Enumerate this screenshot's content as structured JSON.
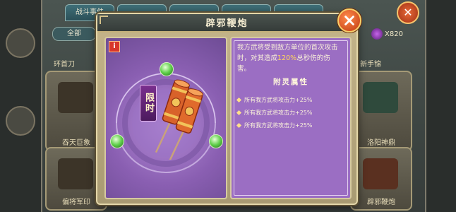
{
  "background": {
    "tabs": [
      "战斗事件",
      "",
      "",
      "",
      ""
    ],
    "filter_label": "全部",
    "currency_value": "X820",
    "cards": [
      {
        "label": "环首刀"
      },
      {
        "label": "吞天巨象"
      },
      {
        "label": "偏将军印"
      },
      {
        "label": "新手锦"
      },
      {
        "label": "洛阳神鼎"
      },
      {
        "label": "辟邪鞭炮"
      }
    ]
  },
  "modal": {
    "title": "辟邪鞭炮",
    "limit_tag": "限时",
    "info_icon_text": "i",
    "description_pre": "我方武将受到敌方单位的首次攻击时，对其造成",
    "description_highlight": "120%",
    "description_post": "总秒伤的伤害。",
    "attributes_title": "附灵属性",
    "attributes": [
      "所有我方武将攻击力+25%",
      "所有我方武将攻击力+25%",
      "所有我方武将攻击力+25%"
    ],
    "colors": {
      "highlight": "#ffd75a",
      "panel_purple": "#9b6ec3",
      "close_orange": "#e85a20"
    },
    "icons": [
      "close-icon",
      "info-icon",
      "firecracker-icon",
      "green-orb-icon"
    ]
  }
}
